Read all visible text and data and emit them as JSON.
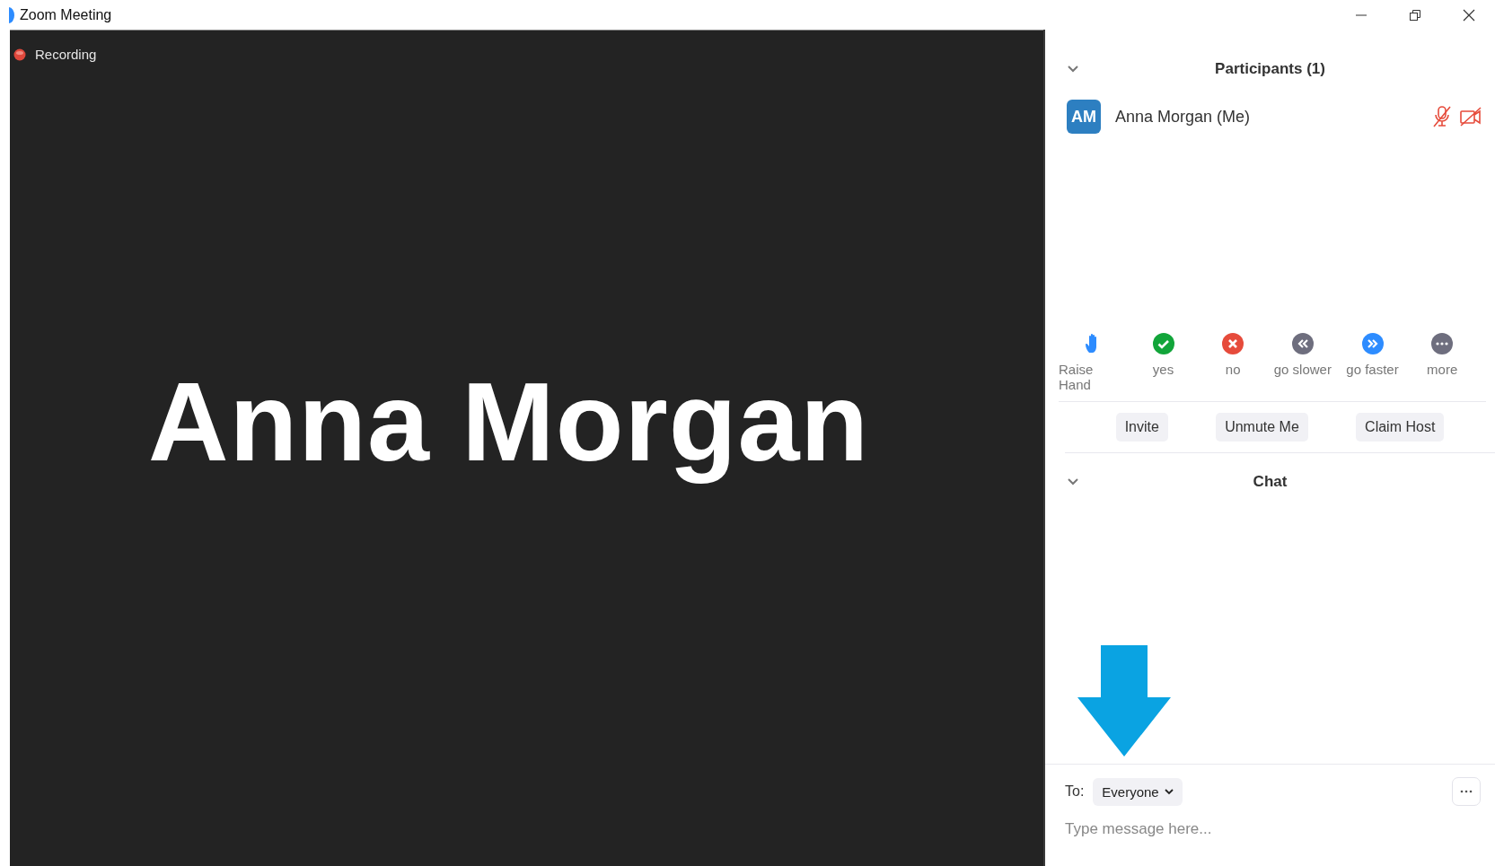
{
  "window": {
    "title": "Zoom Meeting"
  },
  "video": {
    "recording_label": "Recording",
    "recording": true,
    "name": "Anna Morgan"
  },
  "participants": {
    "title": "Participants (1)",
    "expanded": true,
    "items": [
      {
        "initials": "AM",
        "name": "Anna Morgan (Me)",
        "muted": true,
        "video_off": true
      }
    ]
  },
  "reactions": [
    {
      "kind": "hand",
      "label": "Raise Hand",
      "color": "#2d8cff"
    },
    {
      "kind": "check",
      "label": "yes",
      "color": "#12a53a"
    },
    {
      "kind": "cross",
      "label": "no",
      "color": "#e64b3b"
    },
    {
      "kind": "rewind",
      "label": "go slower",
      "color": "#6e6e7e"
    },
    {
      "kind": "forward",
      "label": "go faster",
      "color": "#2d8cff"
    },
    {
      "kind": "dots",
      "label": "more",
      "color": "#6e6e7e"
    }
  ],
  "buttons": [
    "Invite",
    "Unmute Me",
    "Claim Host"
  ],
  "chat": {
    "title": "Chat",
    "expanded": true,
    "to_label": "To:",
    "recipient": "Everyone",
    "placeholder": "Type message here..."
  }
}
